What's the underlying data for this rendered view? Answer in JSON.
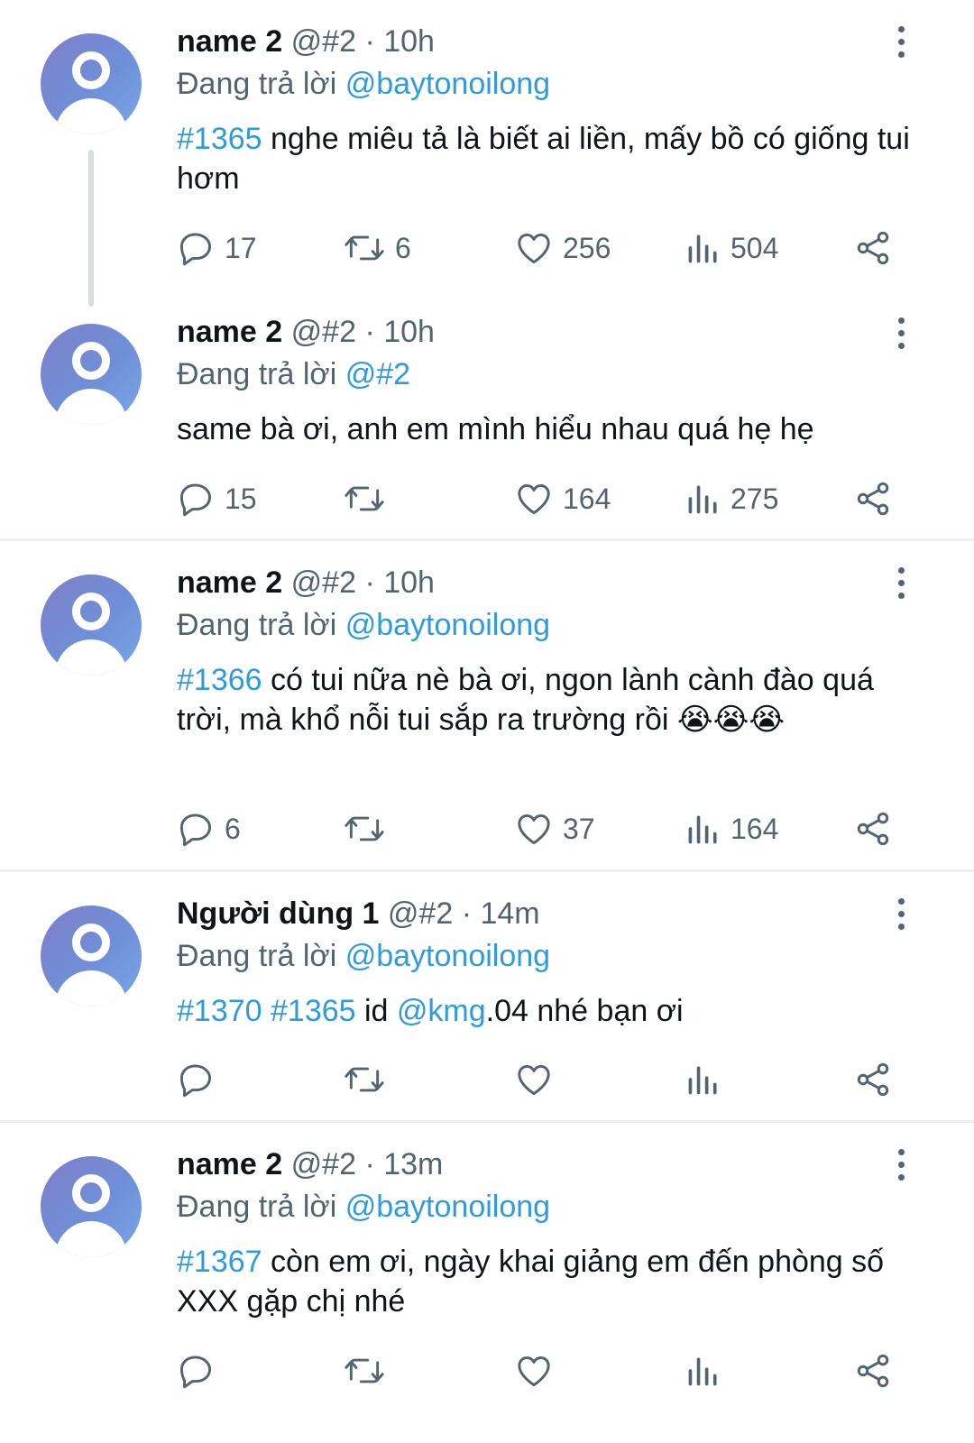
{
  "posts": [
    {
      "author": "name 2",
      "handle": "@#2",
      "time": "10h",
      "reply_prefix": "Đang trả lời",
      "reply_to": "@baytonoilong",
      "body": {
        "tag1": "#1365",
        "text": " nghe miêu tả là biết ai liền, mấy bồ có giống tui hơm"
      },
      "stats": {
        "replies": "17",
        "reposts": "6",
        "likes": "256",
        "views": "504"
      }
    },
    {
      "author": "name 2",
      "handle": "@#2",
      "time": "10h",
      "reply_prefix": "Đang trả lời",
      "reply_to": "@#2",
      "body": {
        "text": "same bà ơi, anh em mình hiểu nhau quá hẹ hẹ"
      },
      "stats": {
        "replies": "15",
        "reposts": "",
        "likes": "164",
        "views": "275"
      }
    },
    {
      "author": "name 2",
      "handle": "@#2",
      "time": "10h",
      "reply_prefix": "Đang trả lời",
      "reply_to": "@baytonoilong",
      "body": {
        "tag1": "#1366",
        "text": " có tui nữa nè bà ơi, ngon lành cành đào quá trời, mà khổ nỗi tui sắp ra trường rồi ",
        "emoji": "😭😭😭"
      },
      "stats": {
        "replies": "6",
        "reposts": "",
        "likes": "37",
        "views": "164"
      }
    },
    {
      "author": "Người dùng 1",
      "handle": "@#2",
      "time": "14m",
      "reply_prefix": "Đang trả lời",
      "reply_to": "@baytonoilong",
      "body": {
        "tag1": "#1370",
        "tag2": "#1365",
        "text_a": " id ",
        "mention": "@kmg",
        "text_b": ".04 nhé bạn ơi"
      },
      "stats": {
        "replies": "",
        "reposts": "",
        "likes": "",
        "views": ""
      }
    },
    {
      "author": "name 2",
      "handle": "@#2",
      "time": "13m",
      "reply_prefix": "Đang trả lời",
      "reply_to": "@baytonoilong",
      "body": {
        "tag1": "#1367",
        "text": " còn em ơi, ngày khai giảng em đến phòng số XXX gặp chị nhé"
      },
      "stats": {
        "replies": "",
        "reposts": "",
        "likes": "",
        "views": ""
      }
    }
  ],
  "separator": "·",
  "icons": [
    "reply-icon",
    "repost-icon",
    "like-icon",
    "views-icon",
    "share-icon",
    "more-icon"
  ],
  "colors": {
    "link": "#2e9be0",
    "muted": "#536471",
    "text": "#0f1419",
    "avatar": "#7f8fd0"
  }
}
